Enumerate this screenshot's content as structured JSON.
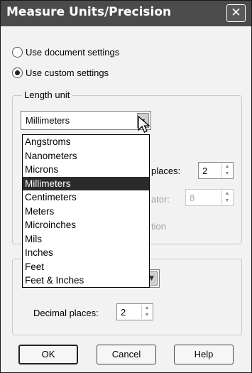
{
  "window": {
    "title": "Measure Units/Precision",
    "close_label": "✕"
  },
  "radios": {
    "document": {
      "label": "Use document settings",
      "selected": false
    },
    "custom": {
      "label": "Use custom settings",
      "selected": true
    }
  },
  "length_unit": {
    "group_label": "Length unit",
    "selected": "Millimeters",
    "options": [
      "Angstroms",
      "Nanometers",
      "Microns",
      "Millimeters",
      "Centimeters",
      "Meters",
      "Microinches",
      "Mils",
      "Inches",
      "Feet",
      "Feet & Inches"
    ],
    "decimal_places_label_partial": "places:",
    "decimal_places_value": "2",
    "denominator_label_partial": "ator:",
    "denominator_value": "8",
    "fraction_label_partial": "tion"
  },
  "second_group": {
    "decimal_places_label": "Decimal places:",
    "decimal_places_value": "2"
  },
  "buttons": {
    "ok": "OK",
    "cancel": "Cancel",
    "help": "Help"
  }
}
